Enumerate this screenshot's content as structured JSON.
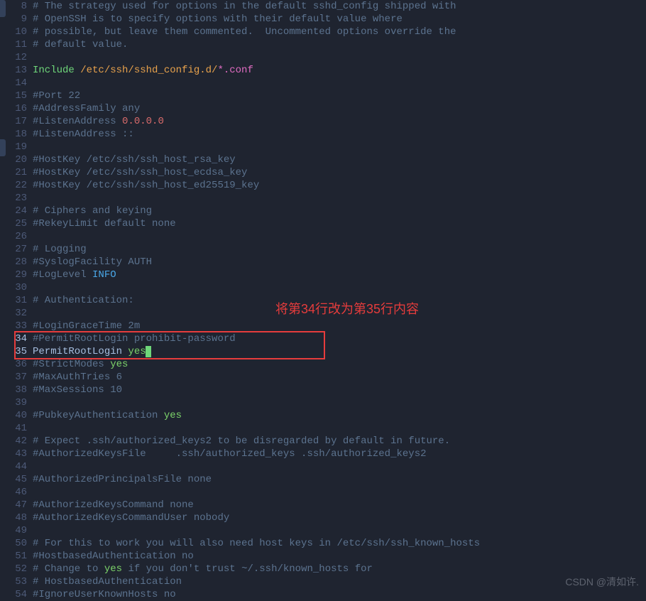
{
  "annotation": "将第34行改为第35行内容",
  "watermark": "CSDN @清如许.",
  "lines": [
    {
      "n": 8,
      "t": "comment",
      "text": "# The strategy used for options in the default sshd_config shipped with"
    },
    {
      "n": 9,
      "t": "comment",
      "text": "# OpenSSH is to specify options with their default value where"
    },
    {
      "n": 10,
      "t": "comment",
      "text": "# possible, but leave them commented.  Uncommented options override the"
    },
    {
      "n": 11,
      "t": "comment",
      "text": "# default value."
    },
    {
      "n": 12,
      "t": "blank",
      "text": ""
    },
    {
      "n": 13,
      "t": "include",
      "parts": {
        "kw": "Include ",
        "path": "/etc/ssh/sshd_config.d/",
        "glob": "*.conf"
      }
    },
    {
      "n": 14,
      "t": "blank",
      "text": ""
    },
    {
      "n": 15,
      "t": "comment",
      "text": "#Port 22"
    },
    {
      "n": 16,
      "t": "comment",
      "text": "#AddressFamily any"
    },
    {
      "n": 17,
      "t": "listen",
      "parts": {
        "pre": "#ListenAddress ",
        "ip": "0.0.0.0"
      }
    },
    {
      "n": 18,
      "t": "comment",
      "text": "#ListenAddress ::"
    },
    {
      "n": 19,
      "t": "blank",
      "text": ""
    },
    {
      "n": 20,
      "t": "comment",
      "text": "#HostKey /etc/ssh/ssh_host_rsa_key"
    },
    {
      "n": 21,
      "t": "comment",
      "text": "#HostKey /etc/ssh/ssh_host_ecdsa_key"
    },
    {
      "n": 22,
      "t": "comment",
      "text": "#HostKey /etc/ssh/ssh_host_ed25519_key"
    },
    {
      "n": 23,
      "t": "blank",
      "text": ""
    },
    {
      "n": 24,
      "t": "comment",
      "text": "# Ciphers and keying"
    },
    {
      "n": 25,
      "t": "comment",
      "text": "#RekeyLimit default none"
    },
    {
      "n": 26,
      "t": "blank",
      "text": ""
    },
    {
      "n": 27,
      "t": "comment",
      "text": "# Logging"
    },
    {
      "n": 28,
      "t": "comment",
      "text": "#SyslogFacility AUTH"
    },
    {
      "n": 29,
      "t": "loglevel",
      "parts": {
        "pre": "#LogLevel ",
        "val": "INFO"
      }
    },
    {
      "n": 30,
      "t": "blank",
      "text": ""
    },
    {
      "n": 31,
      "t": "comment",
      "text": "# Authentication:"
    },
    {
      "n": 32,
      "t": "blank",
      "text": ""
    },
    {
      "n": 33,
      "t": "comment",
      "text": "#LoginGraceTime 2m"
    },
    {
      "n": 34,
      "t": "comment",
      "text": "#PermitRootLogin prohibit-password"
    },
    {
      "n": 35,
      "t": "permit",
      "parts": {
        "key": "PermitRootLogin ",
        "val": "yes"
      }
    },
    {
      "n": 36,
      "t": "strict",
      "parts": {
        "pre": "#StrictModes ",
        "val": "yes"
      }
    },
    {
      "n": 37,
      "t": "comment",
      "text": "#MaxAuthTries 6"
    },
    {
      "n": 38,
      "t": "comment",
      "text": "#MaxSessions 10"
    },
    {
      "n": 39,
      "t": "blank",
      "text": ""
    },
    {
      "n": 40,
      "t": "pubkey",
      "parts": {
        "pre": "#PubkeyAuthentication ",
        "val": "yes"
      }
    },
    {
      "n": 41,
      "t": "blank",
      "text": ""
    },
    {
      "n": 42,
      "t": "comment",
      "text": "# Expect .ssh/authorized_keys2 to be disregarded by default in future."
    },
    {
      "n": 43,
      "t": "comment",
      "text": "#AuthorizedKeysFile     .ssh/authorized_keys .ssh/authorized_keys2"
    },
    {
      "n": 44,
      "t": "blank",
      "text": ""
    },
    {
      "n": 45,
      "t": "comment",
      "text": "#AuthorizedPrincipalsFile none"
    },
    {
      "n": 46,
      "t": "blank",
      "text": ""
    },
    {
      "n": 47,
      "t": "comment",
      "text": "#AuthorizedKeysCommand none"
    },
    {
      "n": 48,
      "t": "comment",
      "text": "#AuthorizedKeysCommandUser nobody"
    },
    {
      "n": 49,
      "t": "blank",
      "text": ""
    },
    {
      "n": 50,
      "t": "comment",
      "text": "# For this to work you will also need host keys in /etc/ssh/ssh_known_hosts"
    },
    {
      "n": 51,
      "t": "comment",
      "text": "#HostbasedAuthentication no"
    },
    {
      "n": 52,
      "t": "change",
      "parts": {
        "a": "# Change to ",
        "b": "yes",
        "c": " if you don't trust ~/.ssh/known_hosts for"
      }
    },
    {
      "n": 53,
      "t": "comment",
      "text": "# HostbasedAuthentication"
    },
    {
      "n": 54,
      "t": "comment",
      "text": "#IgnoreUserKnownHosts no"
    }
  ]
}
